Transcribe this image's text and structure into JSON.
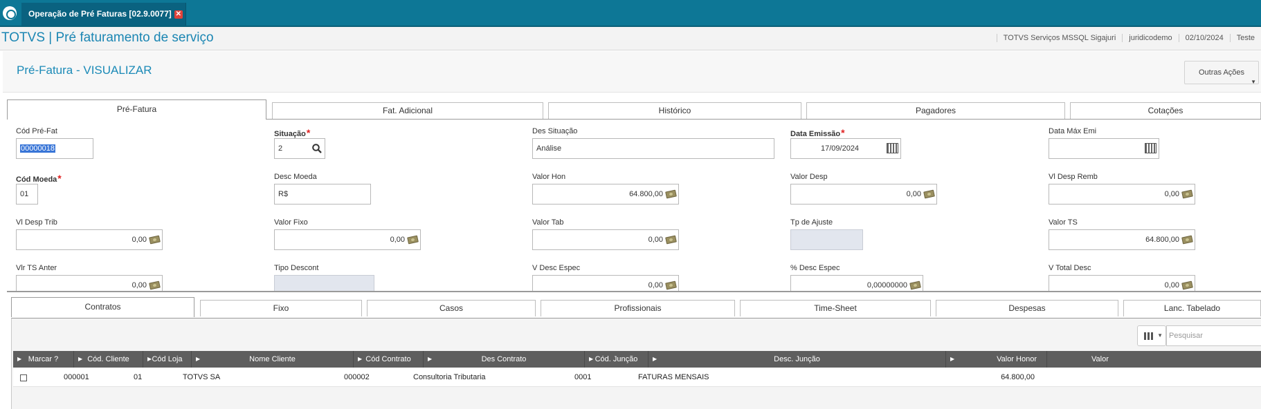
{
  "window": {
    "title": "Operação de Pré Faturas [02.9.0077]",
    "close_glyph": "✕"
  },
  "app": {
    "title": "TOTVS | Pré faturamento de serviço",
    "info": [
      "TOTVS Serviços MSSQL Sigajuri",
      "juridicodemo",
      "02/10/2024",
      "Teste"
    ]
  },
  "page": {
    "title": "Pré-Fatura - VISUALIZAR",
    "more_actions": "Outras Ações"
  },
  "tabs": [
    "Pré-Fatura",
    "Fat. Adicional",
    "Histórico",
    "Pagadores",
    "Cotações"
  ],
  "form": {
    "cod_prefat": {
      "label": "Cód Pré-Fat",
      "value": "00000018"
    },
    "situacao": {
      "label": "Situação",
      "value": "2"
    },
    "des_situacao": {
      "label": "Des Situação",
      "value": "Análise"
    },
    "data_emissao": {
      "label": "Data Emissão",
      "value": "17/09/2024"
    },
    "data_max_emi": {
      "label": "Data Máx Emi",
      "value": "  /  /"
    },
    "cod_moeda": {
      "label": "Cód Moeda",
      "value": "01"
    },
    "desc_moeda": {
      "label": "Desc Moeda",
      "value": "R$"
    },
    "valor_hon": {
      "label": "Valor Hon",
      "value": "64.800,00"
    },
    "valor_desp": {
      "label": "Valor Desp",
      "value": "0,00"
    },
    "vl_desp_remb": {
      "label": "Vl Desp Remb",
      "value": "0,00"
    },
    "vl_desp_trib": {
      "label": "Vl Desp Trib",
      "value": "0,00"
    },
    "valor_fixo": {
      "label": "Valor Fixo",
      "value": "0,00"
    },
    "valor_tab": {
      "label": "Valor Tab",
      "value": "0,00"
    },
    "tp_ajuste": {
      "label": "Tp de Ajuste",
      "value": ""
    },
    "valor_ts": {
      "label": "Valor TS",
      "value": "64.800,00"
    },
    "vlr_ts_anter": {
      "label": "Vlr TS Anter",
      "value": "0,00"
    },
    "tipo_descont": {
      "label": "Tipo Descont",
      "value": ""
    },
    "v_desc_espec": {
      "label": "V Desc Espec",
      "value": "0,00"
    },
    "pct_desc_espec": {
      "label": "% Desc Espec",
      "value": "0,00000000"
    },
    "v_total_desc": {
      "label": "V Total Desc",
      "value": "0,00"
    }
  },
  "subtabs": [
    "Contratos",
    "Fixo",
    "Casos",
    "Profissionais",
    "Time-Sheet",
    "Despesas",
    "Lanc. Tabelado"
  ],
  "grid": {
    "search_placeholder": "Pesquisar",
    "columns": [
      "Marcar ?",
      "Cód. Cliente",
      "Cód Loja",
      "Nome Cliente",
      "Cód Contrato",
      "Des Contrato",
      "Cód. Junção",
      "Desc. Junção",
      "Valor Honor",
      "Valor"
    ],
    "rows": [
      {
        "cod_cliente": "000001",
        "cod_loja": "01",
        "nome_cliente": "TOTVS SA",
        "cod_contrato": "000002",
        "des_contrato": "Consultoria Tributaria",
        "cod_juncao": "0001",
        "desc_juncao": "FATURAS MENSAIS",
        "valor_honor": "64.800,00"
      }
    ]
  },
  "icons": {
    "logo": "totvs-logo-icon",
    "lookup": "search-icon",
    "calendar": "calendar-icon",
    "money": "money-icon",
    "columns": "columns-icon"
  },
  "colors": {
    "topbar": "#0d7796",
    "accent": "#1b86b3",
    "required": "#e02020",
    "grid_header": "#5e5e5e"
  }
}
